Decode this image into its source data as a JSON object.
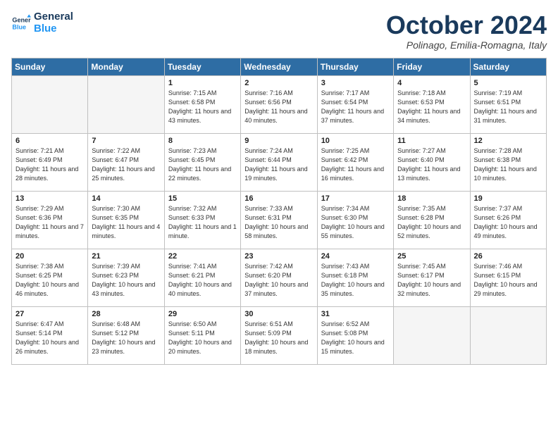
{
  "logo": {
    "line1": "General",
    "line2": "Blue"
  },
  "title": "October 2024",
  "subtitle": "Polinago, Emilia-Romagna, Italy",
  "header_days": [
    "Sunday",
    "Monday",
    "Tuesday",
    "Wednesday",
    "Thursday",
    "Friday",
    "Saturday"
  ],
  "weeks": [
    [
      {
        "day": "",
        "info": ""
      },
      {
        "day": "",
        "info": ""
      },
      {
        "day": "1",
        "info": "Sunrise: 7:15 AM\nSunset: 6:58 PM\nDaylight: 11 hours and 43 minutes."
      },
      {
        "day": "2",
        "info": "Sunrise: 7:16 AM\nSunset: 6:56 PM\nDaylight: 11 hours and 40 minutes."
      },
      {
        "day": "3",
        "info": "Sunrise: 7:17 AM\nSunset: 6:54 PM\nDaylight: 11 hours and 37 minutes."
      },
      {
        "day": "4",
        "info": "Sunrise: 7:18 AM\nSunset: 6:53 PM\nDaylight: 11 hours and 34 minutes."
      },
      {
        "day": "5",
        "info": "Sunrise: 7:19 AM\nSunset: 6:51 PM\nDaylight: 11 hours and 31 minutes."
      }
    ],
    [
      {
        "day": "6",
        "info": "Sunrise: 7:21 AM\nSunset: 6:49 PM\nDaylight: 11 hours and 28 minutes."
      },
      {
        "day": "7",
        "info": "Sunrise: 7:22 AM\nSunset: 6:47 PM\nDaylight: 11 hours and 25 minutes."
      },
      {
        "day": "8",
        "info": "Sunrise: 7:23 AM\nSunset: 6:45 PM\nDaylight: 11 hours and 22 minutes."
      },
      {
        "day": "9",
        "info": "Sunrise: 7:24 AM\nSunset: 6:44 PM\nDaylight: 11 hours and 19 minutes."
      },
      {
        "day": "10",
        "info": "Sunrise: 7:25 AM\nSunset: 6:42 PM\nDaylight: 11 hours and 16 minutes."
      },
      {
        "day": "11",
        "info": "Sunrise: 7:27 AM\nSunset: 6:40 PM\nDaylight: 11 hours and 13 minutes."
      },
      {
        "day": "12",
        "info": "Sunrise: 7:28 AM\nSunset: 6:38 PM\nDaylight: 11 hours and 10 minutes."
      }
    ],
    [
      {
        "day": "13",
        "info": "Sunrise: 7:29 AM\nSunset: 6:36 PM\nDaylight: 11 hours and 7 minutes."
      },
      {
        "day": "14",
        "info": "Sunrise: 7:30 AM\nSunset: 6:35 PM\nDaylight: 11 hours and 4 minutes."
      },
      {
        "day": "15",
        "info": "Sunrise: 7:32 AM\nSunset: 6:33 PM\nDaylight: 11 hours and 1 minute."
      },
      {
        "day": "16",
        "info": "Sunrise: 7:33 AM\nSunset: 6:31 PM\nDaylight: 10 hours and 58 minutes."
      },
      {
        "day": "17",
        "info": "Sunrise: 7:34 AM\nSunset: 6:30 PM\nDaylight: 10 hours and 55 minutes."
      },
      {
        "day": "18",
        "info": "Sunrise: 7:35 AM\nSunset: 6:28 PM\nDaylight: 10 hours and 52 minutes."
      },
      {
        "day": "19",
        "info": "Sunrise: 7:37 AM\nSunset: 6:26 PM\nDaylight: 10 hours and 49 minutes."
      }
    ],
    [
      {
        "day": "20",
        "info": "Sunrise: 7:38 AM\nSunset: 6:25 PM\nDaylight: 10 hours and 46 minutes."
      },
      {
        "day": "21",
        "info": "Sunrise: 7:39 AM\nSunset: 6:23 PM\nDaylight: 10 hours and 43 minutes."
      },
      {
        "day": "22",
        "info": "Sunrise: 7:41 AM\nSunset: 6:21 PM\nDaylight: 10 hours and 40 minutes."
      },
      {
        "day": "23",
        "info": "Sunrise: 7:42 AM\nSunset: 6:20 PM\nDaylight: 10 hours and 37 minutes."
      },
      {
        "day": "24",
        "info": "Sunrise: 7:43 AM\nSunset: 6:18 PM\nDaylight: 10 hours and 35 minutes."
      },
      {
        "day": "25",
        "info": "Sunrise: 7:45 AM\nSunset: 6:17 PM\nDaylight: 10 hours and 32 minutes."
      },
      {
        "day": "26",
        "info": "Sunrise: 7:46 AM\nSunset: 6:15 PM\nDaylight: 10 hours and 29 minutes."
      }
    ],
    [
      {
        "day": "27",
        "info": "Sunrise: 6:47 AM\nSunset: 5:14 PM\nDaylight: 10 hours and 26 minutes."
      },
      {
        "day": "28",
        "info": "Sunrise: 6:48 AM\nSunset: 5:12 PM\nDaylight: 10 hours and 23 minutes."
      },
      {
        "day": "29",
        "info": "Sunrise: 6:50 AM\nSunset: 5:11 PM\nDaylight: 10 hours and 20 minutes."
      },
      {
        "day": "30",
        "info": "Sunrise: 6:51 AM\nSunset: 5:09 PM\nDaylight: 10 hours and 18 minutes."
      },
      {
        "day": "31",
        "info": "Sunrise: 6:52 AM\nSunset: 5:08 PM\nDaylight: 10 hours and 15 minutes."
      },
      {
        "day": "",
        "info": ""
      },
      {
        "day": "",
        "info": ""
      }
    ]
  ]
}
